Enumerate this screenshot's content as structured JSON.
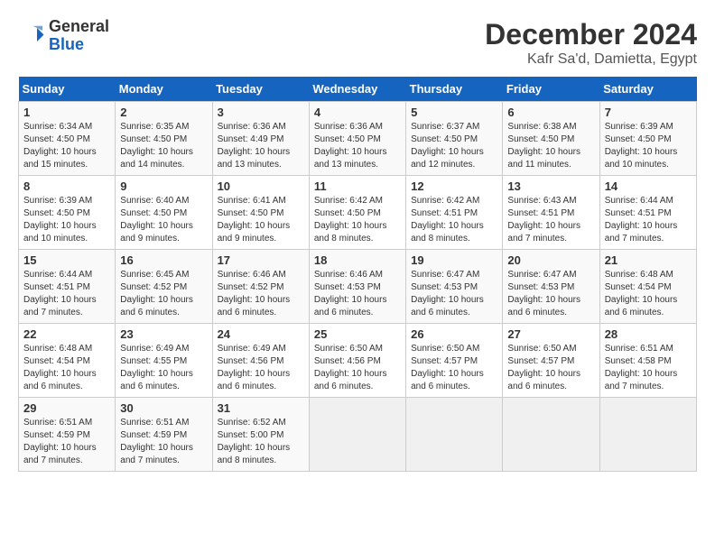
{
  "header": {
    "logo_general": "General",
    "logo_blue": "Blue",
    "month_title": "December 2024",
    "location": "Kafr Sa'd, Damietta, Egypt"
  },
  "weekdays": [
    "Sunday",
    "Monday",
    "Tuesday",
    "Wednesday",
    "Thursday",
    "Friday",
    "Saturday"
  ],
  "weeks": [
    [
      {
        "day": "1",
        "info": "Sunrise: 6:34 AM\nSunset: 4:50 PM\nDaylight: 10 hours\nand 15 minutes."
      },
      {
        "day": "2",
        "info": "Sunrise: 6:35 AM\nSunset: 4:50 PM\nDaylight: 10 hours\nand 14 minutes."
      },
      {
        "day": "3",
        "info": "Sunrise: 6:36 AM\nSunset: 4:49 PM\nDaylight: 10 hours\nand 13 minutes."
      },
      {
        "day": "4",
        "info": "Sunrise: 6:36 AM\nSunset: 4:50 PM\nDaylight: 10 hours\nand 13 minutes."
      },
      {
        "day": "5",
        "info": "Sunrise: 6:37 AM\nSunset: 4:50 PM\nDaylight: 10 hours\nand 12 minutes."
      },
      {
        "day": "6",
        "info": "Sunrise: 6:38 AM\nSunset: 4:50 PM\nDaylight: 10 hours\nand 11 minutes."
      },
      {
        "day": "7",
        "info": "Sunrise: 6:39 AM\nSunset: 4:50 PM\nDaylight: 10 hours\nand 10 minutes."
      }
    ],
    [
      {
        "day": "8",
        "info": "Sunrise: 6:39 AM\nSunset: 4:50 PM\nDaylight: 10 hours\nand 10 minutes."
      },
      {
        "day": "9",
        "info": "Sunrise: 6:40 AM\nSunset: 4:50 PM\nDaylight: 10 hours\nand 9 minutes."
      },
      {
        "day": "10",
        "info": "Sunrise: 6:41 AM\nSunset: 4:50 PM\nDaylight: 10 hours\nand 9 minutes."
      },
      {
        "day": "11",
        "info": "Sunrise: 6:42 AM\nSunset: 4:50 PM\nDaylight: 10 hours\nand 8 minutes."
      },
      {
        "day": "12",
        "info": "Sunrise: 6:42 AM\nSunset: 4:51 PM\nDaylight: 10 hours\nand 8 minutes."
      },
      {
        "day": "13",
        "info": "Sunrise: 6:43 AM\nSunset: 4:51 PM\nDaylight: 10 hours\nand 7 minutes."
      },
      {
        "day": "14",
        "info": "Sunrise: 6:44 AM\nSunset: 4:51 PM\nDaylight: 10 hours\nand 7 minutes."
      }
    ],
    [
      {
        "day": "15",
        "info": "Sunrise: 6:44 AM\nSunset: 4:51 PM\nDaylight: 10 hours\nand 7 minutes."
      },
      {
        "day": "16",
        "info": "Sunrise: 6:45 AM\nSunset: 4:52 PM\nDaylight: 10 hours\nand 6 minutes."
      },
      {
        "day": "17",
        "info": "Sunrise: 6:46 AM\nSunset: 4:52 PM\nDaylight: 10 hours\nand 6 minutes."
      },
      {
        "day": "18",
        "info": "Sunrise: 6:46 AM\nSunset: 4:53 PM\nDaylight: 10 hours\nand 6 minutes."
      },
      {
        "day": "19",
        "info": "Sunrise: 6:47 AM\nSunset: 4:53 PM\nDaylight: 10 hours\nand 6 minutes."
      },
      {
        "day": "20",
        "info": "Sunrise: 6:47 AM\nSunset: 4:53 PM\nDaylight: 10 hours\nand 6 minutes."
      },
      {
        "day": "21",
        "info": "Sunrise: 6:48 AM\nSunset: 4:54 PM\nDaylight: 10 hours\nand 6 minutes."
      }
    ],
    [
      {
        "day": "22",
        "info": "Sunrise: 6:48 AM\nSunset: 4:54 PM\nDaylight: 10 hours\nand 6 minutes."
      },
      {
        "day": "23",
        "info": "Sunrise: 6:49 AM\nSunset: 4:55 PM\nDaylight: 10 hours\nand 6 minutes."
      },
      {
        "day": "24",
        "info": "Sunrise: 6:49 AM\nSunset: 4:56 PM\nDaylight: 10 hours\nand 6 minutes."
      },
      {
        "day": "25",
        "info": "Sunrise: 6:50 AM\nSunset: 4:56 PM\nDaylight: 10 hours\nand 6 minutes."
      },
      {
        "day": "26",
        "info": "Sunrise: 6:50 AM\nSunset: 4:57 PM\nDaylight: 10 hours\nand 6 minutes."
      },
      {
        "day": "27",
        "info": "Sunrise: 6:50 AM\nSunset: 4:57 PM\nDaylight: 10 hours\nand 6 minutes."
      },
      {
        "day": "28",
        "info": "Sunrise: 6:51 AM\nSunset: 4:58 PM\nDaylight: 10 hours\nand 7 minutes."
      }
    ],
    [
      {
        "day": "29",
        "info": "Sunrise: 6:51 AM\nSunset: 4:59 PM\nDaylight: 10 hours\nand 7 minutes."
      },
      {
        "day": "30",
        "info": "Sunrise: 6:51 AM\nSunset: 4:59 PM\nDaylight: 10 hours\nand 7 minutes."
      },
      {
        "day": "31",
        "info": "Sunrise: 6:52 AM\nSunset: 5:00 PM\nDaylight: 10 hours\nand 8 minutes."
      },
      {
        "day": "",
        "info": ""
      },
      {
        "day": "",
        "info": ""
      },
      {
        "day": "",
        "info": ""
      },
      {
        "day": "",
        "info": ""
      }
    ]
  ]
}
